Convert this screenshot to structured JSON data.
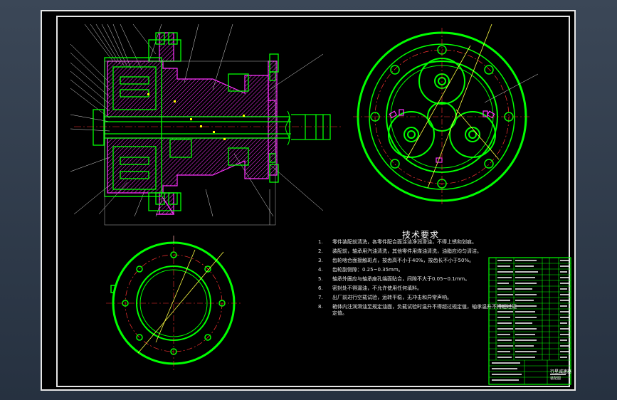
{
  "technical_requirements": {
    "title": "技术要求",
    "notes": [
      {
        "num": "1.",
        "text": "零件装配前清洗，各零件配合面涂洁净润滑油，不得上锈和划痕。"
      },
      {
        "num": "2.",
        "text": "装配前，轴承用汽油清洗，其他零件用煤油清洗，油脂应均匀清洁。"
      },
      {
        "num": "3.",
        "text": "齿轮啮合面接触斑点，按齿高不小于40%，按齿长不小于50%。"
      },
      {
        "num": "4.",
        "text": "齿轮副侧隙：0.25~0.35mm。"
      },
      {
        "num": "5.",
        "text": "轴承外圈应与轴承座孔端面贴合，间隙不大于0.05~0.1mm。"
      },
      {
        "num": "6.",
        "text": "密封处不得漏油，不允许使用任何填料。"
      },
      {
        "num": "7.",
        "text": "出厂前进行空载试验，运转平稳，无冲击和异常声响。"
      },
      {
        "num": "8.",
        "text": "箱体内注润滑油至规定油面，负载试验时温升不得超过规定值，轴承温升不得超过规定值。"
      }
    ]
  },
  "title_block": {
    "drawing_title": "行星减速器",
    "drawing_no": "装配图"
  }
}
